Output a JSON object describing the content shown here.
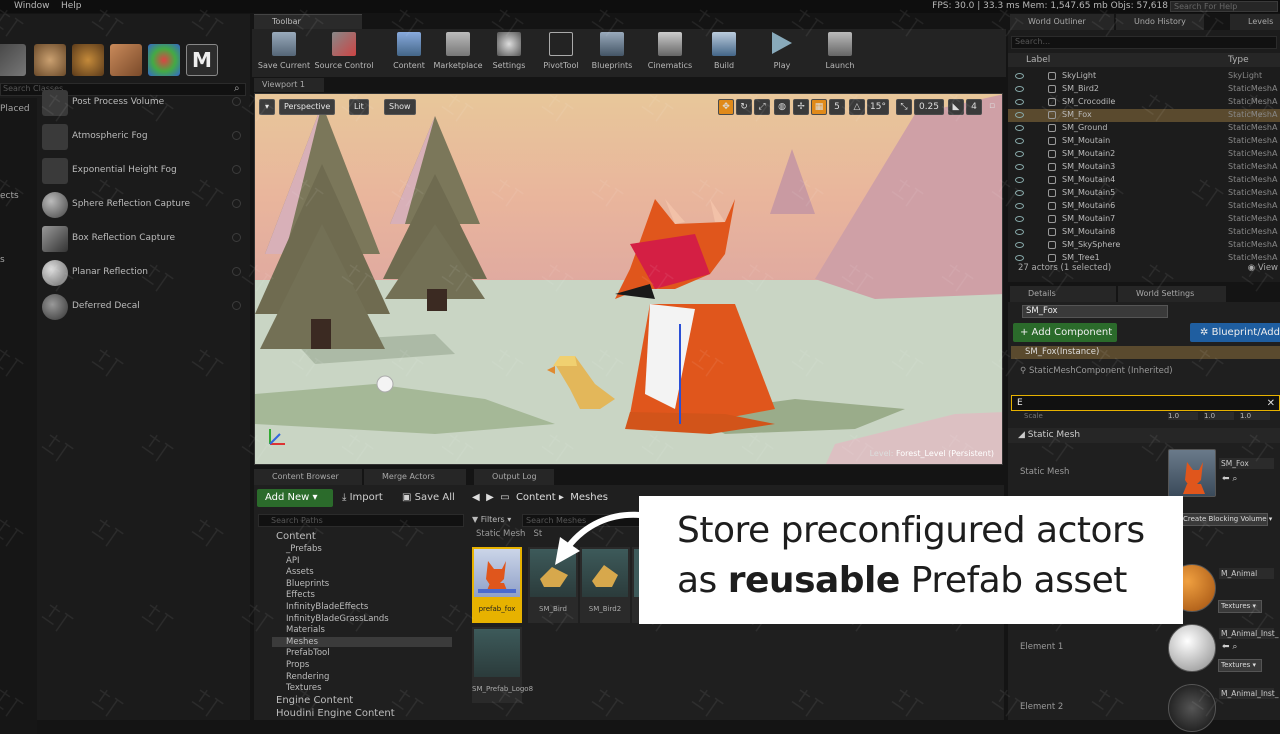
{
  "menubar": {
    "items": [
      "Window",
      "Help"
    ],
    "stats": "FPS: 30.0 | 33.3 ms   Mem: 1,547.65 mb   Objs: 57,618",
    "help_placeholder": "Search For Help"
  },
  "modes": {
    "search_placeholder": "Search Classes",
    "categories": [
      "Placed",
      "ects",
      "s"
    ],
    "items": [
      {
        "label": "Post Process Volume"
      },
      {
        "label": "Atmospheric Fog"
      },
      {
        "label": "Exponential Height Fog"
      },
      {
        "label": "Sphere Reflection Capture"
      },
      {
        "label": "Box Reflection Capture"
      },
      {
        "label": "Planar Reflection"
      },
      {
        "label": "Deferred Decal"
      }
    ]
  },
  "toolbar": {
    "tab": "Toolbar",
    "buttons": [
      "Save Current",
      "Source Control",
      "Content",
      "Marketplace",
      "Settings",
      "PivotTool",
      "Blueprints",
      "Cinematics",
      "Build",
      "Play",
      "Launch"
    ]
  },
  "viewport": {
    "tab": "Viewport 1",
    "perspective": "Perspective",
    "lit": "Lit",
    "show": "Show",
    "snap_grid": "5",
    "snap_rot": "15°",
    "snap_scale": "0.25",
    "cam_speed": "4",
    "level_prefix": "Level:",
    "level_name": "Forest_Level (Persistent)"
  },
  "content_browser": {
    "tabs": [
      "Content Browser",
      "Merge Actors",
      "Output Log"
    ],
    "add_new": "Add New",
    "import": "Import",
    "save_all": "Save All",
    "search_paths_placeholder": "Search Paths",
    "path": [
      "Content",
      "Meshes"
    ],
    "filters": "Filters",
    "search_assets_placeholder": "Search Meshes",
    "crumb_tab": "Static Mesh",
    "crumb_tab2": "St",
    "folders": [
      {
        "label": "Content",
        "depth": 0,
        "big": true
      },
      {
        "label": "_Prefabs",
        "depth": 1
      },
      {
        "label": "API",
        "depth": 1
      },
      {
        "label": "Assets",
        "depth": 1
      },
      {
        "label": "Blueprints",
        "depth": 1
      },
      {
        "label": "Effects",
        "depth": 1
      },
      {
        "label": "InfinityBladeEffects",
        "depth": 1
      },
      {
        "label": "InfinityBladeGrassLands",
        "depth": 1
      },
      {
        "label": "Materials",
        "depth": 1
      },
      {
        "label": "Meshes",
        "depth": 1,
        "selected": true
      },
      {
        "label": "PrefabTool",
        "depth": 1
      },
      {
        "label": "Props",
        "depth": 1
      },
      {
        "label": "Rendering",
        "depth": 1
      },
      {
        "label": "Textures",
        "depth": 1
      },
      {
        "label": "Engine Content",
        "depth": 0,
        "big": true
      },
      {
        "label": "Houdini Engine Content",
        "depth": 0,
        "big": true
      }
    ],
    "assets": [
      {
        "label": "prefab_fox",
        "selected": true
      },
      {
        "label": "SM_Bird"
      },
      {
        "label": "SM_Bird2"
      },
      {
        "label": ""
      },
      {
        "label": "SM_Prefab_Logo8"
      }
    ]
  },
  "outliner": {
    "tabs": [
      "World Outliner",
      "Undo History",
      "Levels"
    ],
    "search_placeholder": "Search...",
    "col_label": "Label",
    "col_type": "Type",
    "rows": [
      {
        "name": "SkyLight",
        "type": "SkyLight"
      },
      {
        "name": "SM_Bird2",
        "type": "StaticMeshA"
      },
      {
        "name": "SM_Crocodile",
        "type": "StaticMeshA"
      },
      {
        "name": "SM_Fox",
        "type": "StaticMeshA",
        "selected": true
      },
      {
        "name": "SM_Ground",
        "type": "StaticMeshA"
      },
      {
        "name": "SM_Moutain",
        "type": "StaticMeshA"
      },
      {
        "name": "SM_Moutain2",
        "type": "StaticMeshA"
      },
      {
        "name": "SM_Moutain3",
        "type": "StaticMeshA"
      },
      {
        "name": "SM_Moutain4",
        "type": "StaticMeshA"
      },
      {
        "name": "SM_Moutain5",
        "type": "StaticMeshA"
      },
      {
        "name": "SM_Moutain6",
        "type": "StaticMeshA"
      },
      {
        "name": "SM_Moutain7",
        "type": "StaticMeshA"
      },
      {
        "name": "SM_Moutain8",
        "type": "StaticMeshA"
      },
      {
        "name": "SM_SkySphere",
        "type": "StaticMeshA"
      },
      {
        "name": "SM_Tree1",
        "type": "StaticMeshA"
      }
    ],
    "footer": "27 actors (1 selected)",
    "view": "View"
  },
  "details": {
    "tabs": [
      "Details",
      "World Settings"
    ],
    "name": "SM_Fox",
    "add_component": "+ Add Component",
    "blueprint_add": "Blueprint/Add",
    "instance": "SM_Fox(Instance)",
    "mesh_component": "StaticMeshComponent (Inherited)",
    "search_value": "E",
    "scale_label": "Scale",
    "scale_values": [
      "1.0",
      "1.0",
      "1.0"
    ],
    "section": "Static Mesh",
    "static_mesh_label": "Static Mesh",
    "static_mesh_value": "SM_Fox",
    "blocking_volume": "Create Blocking Volume",
    "materials": [
      {
        "label": "",
        "value": "M_Animal",
        "drop": "Textures"
      },
      {
        "label": "Element 1",
        "value": "M_Animal_Inst_",
        "drop": "Textures"
      },
      {
        "label": "Element 2",
        "value": "M_Animal_Inst_"
      }
    ]
  },
  "callout": {
    "line1": "Store preconfigured actors",
    "line2_pre": "as ",
    "line2_bold": "reusable",
    "line2_post": " Prefab asset"
  },
  "colors": {
    "selection": "#e7b200",
    "add_green": "#2b6b2b",
    "blueprint_blue": "#1f5ea0",
    "sky_top": "#e8c79a",
    "ground": "#c9d5c4",
    "fox_orange": "#e0561c",
    "mountain_pink": "#cfa0a6"
  }
}
